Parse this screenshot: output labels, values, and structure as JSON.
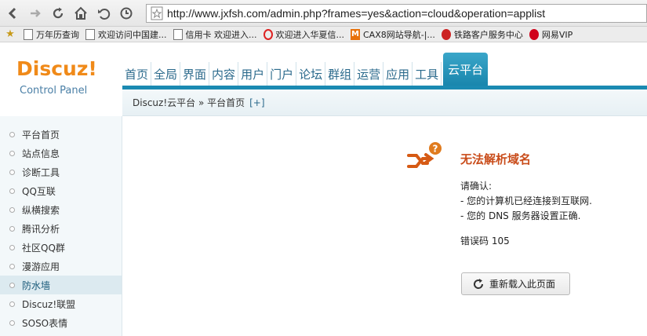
{
  "browser": {
    "url": "http://www.jxfsh.com/admin.php?frames=yes&action=cloud&operation=applist",
    "bookmarks": [
      {
        "label": "万年历查询",
        "icon": "doc-icon"
      },
      {
        "label": "欢迎访问中国建...",
        "icon": "doc-icon"
      },
      {
        "label": "信用卡 欢迎进入...",
        "icon": "doc-icon"
      },
      {
        "label": "欢迎进入华夏信...",
        "icon": "c-logo-icon"
      },
      {
        "label": "CAX8网站导航-|...",
        "icon": "m-logo-icon"
      },
      {
        "label": "铁路客户服务中心",
        "icon": "railway-icon"
      },
      {
        "label": "网易VIP",
        "icon": "netease-icon"
      }
    ]
  },
  "header": {
    "logo_main": "Discuz!",
    "logo_sub": "Control Panel",
    "nav": [
      "首页",
      "全局",
      "界面",
      "内容",
      "用户",
      "门户",
      "论坛",
      "群组",
      "运营",
      "应用",
      "工具",
      "云平台"
    ],
    "active_nav": "云平台",
    "breadcrumb": "Discuz!云平台 » 平台首页",
    "breadcrumb_add": "[+]"
  },
  "sidebar": {
    "items": [
      {
        "label": "平台首页"
      },
      {
        "label": "站点信息"
      },
      {
        "label": "诊断工具"
      },
      {
        "label": "QQ互联"
      },
      {
        "label": "纵横搜索"
      },
      {
        "label": "腾讯分析"
      },
      {
        "label": "社区QQ群"
      },
      {
        "label": "漫游应用"
      },
      {
        "label": "防水墙"
      },
      {
        "label": "Discuz!联盟"
      },
      {
        "label": "SOSO表情"
      }
    ],
    "active_index": 8
  },
  "error": {
    "title": "无法解析域名",
    "confirm": "请确认:",
    "lines": [
      "- 您的计算机已经连接到互联网.",
      "- 您的 DNS 服务器设置正确."
    ],
    "code": "错误码 105",
    "reload_label": "重新载入此页面"
  },
  "colors": {
    "accent": "#1b8ab2",
    "logo": "#f08a19",
    "error_title": "#c94c1a"
  }
}
